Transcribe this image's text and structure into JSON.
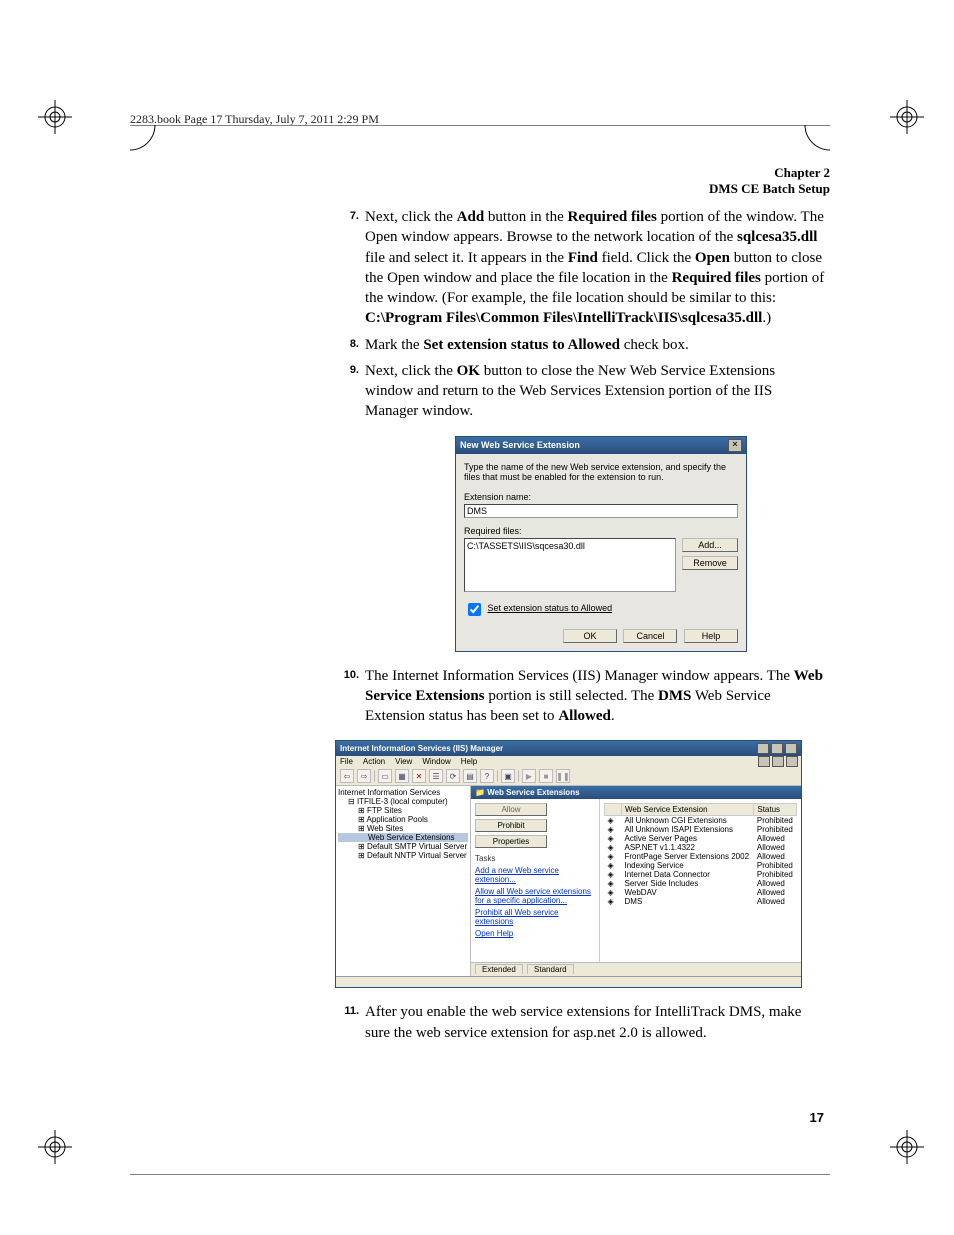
{
  "running_head": "2283.book  Page 17  Thursday, July 7, 2011  2:29 PM",
  "header": {
    "chapter": "Chapter 2",
    "title": "DMS CE Batch Setup"
  },
  "steps": {
    "s7num": "7.",
    "s7": "Next, click the <b>Add</b> button in the <b>Required files</b> portion of the window. The Open window appears. Browse to the network location of the <b>sqlcesa35.dll</b> file and select it. It appears in the <b>Find</b> field. Click the <b>Open</b> button to close the Open window and place the file location in the <b>Required files</b> portion of the window. (For example, the file location should be similar to this: <b>C:\\Program Files\\Common Files\\IntelliTrack\\IIS\\sqlcesa35.dll</b>.)",
    "s8num": "8.",
    "s8": "Mark the <b>Set extension status to Allowed</b> check box.",
    "s9num": "9.",
    "s9": "Next, click the <b>OK</b> button to close the New Web Service Extensions window and return to the Web Services Extension portion of the IIS Manager window.",
    "s10num": "10.",
    "s10": "The Internet Information Services (IIS) Manager window appears. The <b>Web Service Extensions</b> portion is still selected. The <b>DMS</b> Web Service Extension status has been set to <b>Allowed</b>.",
    "s11num": "11.",
    "s11": "After you enable the web service extensions for IntelliTrack DMS, make sure the web service extension for asp.net 2.0 is allowed."
  },
  "dlg1": {
    "title": "New Web Service Extension",
    "desc": "Type the name of the new Web service extension, and specify the files that must be enabled for the extension to run.",
    "extname_label": "Extension name:",
    "extname_value": "DMS",
    "reqfiles_label": "Required files:",
    "file0": "C:\\TASSETS\\IIS\\sqcesa30.dll",
    "add": "Add...",
    "remove": "Remove",
    "chk": "Set extension status to Allowed",
    "ok": "OK",
    "cancel": "Cancel",
    "help": "Help"
  },
  "iis": {
    "title": "Internet Information Services (IIS) Manager",
    "menu": {
      "file": "File",
      "action": "Action",
      "view": "View",
      "window": "Window",
      "help": "Help"
    },
    "tree": {
      "root": "Internet Information Services",
      "n1": "ITFILE-3 (local computer)",
      "n2": "FTP Sites",
      "n3": "Application Pools",
      "n4": "Web Sites",
      "n5": "Web Service Extensions",
      "n6": "Default SMTP Virtual Server",
      "n7": "Default NNTP Virtual Server"
    },
    "pane_title": "Web Service Extensions",
    "btn_allow": "Allow",
    "btn_prohibit": "Prohibit",
    "btn_props": "Properties",
    "tasks_label": "Tasks",
    "link1": "Add a new Web service extension...",
    "link2": "Allow all Web service extensions for a specific application...",
    "link3": "Prohibit all Web service extensions",
    "link4": "Open Help",
    "col1": "Web Service Extension",
    "col2": "Status",
    "rows": [
      {
        "name": "All Unknown CGI Extensions",
        "status": "Prohibited"
      },
      {
        "name": "All Unknown ISAPI Extensions",
        "status": "Prohibited"
      },
      {
        "name": "Active Server Pages",
        "status": "Allowed"
      },
      {
        "name": "ASP.NET v1.1.4322",
        "status": "Allowed"
      },
      {
        "name": "FrontPage Server Extensions 2002",
        "status": "Allowed"
      },
      {
        "name": "Indexing Service",
        "status": "Prohibited"
      },
      {
        "name": "Internet Data Connector",
        "status": "Prohibited"
      },
      {
        "name": "Server Side Includes",
        "status": "Allowed"
      },
      {
        "name": "WebDAV",
        "status": "Allowed"
      },
      {
        "name": "DMS",
        "status": "Allowed"
      }
    ],
    "tab1": "Extended",
    "tab2": "Standard"
  },
  "pagenum": "17"
}
